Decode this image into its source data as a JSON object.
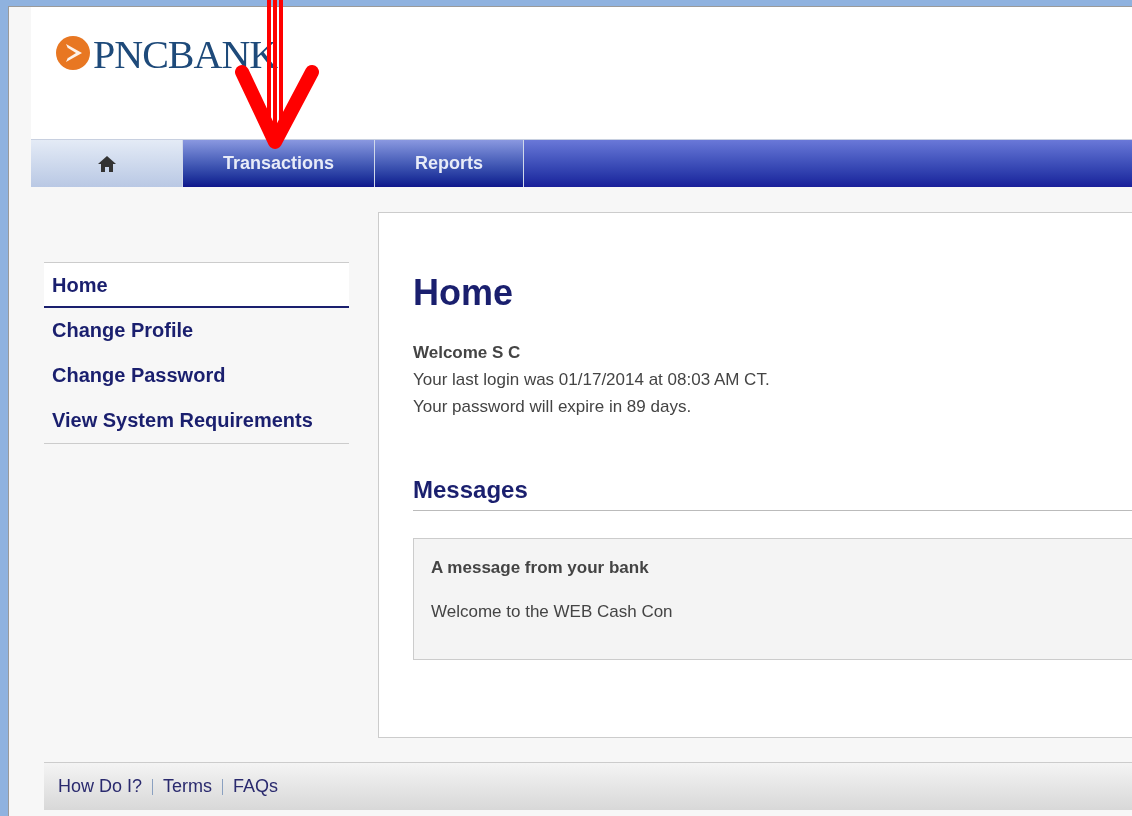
{
  "logo": {
    "text": "PNCBANK"
  },
  "nav_tabs": [
    {
      "kind": "icon",
      "selected": true
    },
    {
      "kind": "text",
      "label": "Transactions",
      "selected": false
    },
    {
      "kind": "text",
      "label": "Reports",
      "selected": false
    }
  ],
  "sidebar": {
    "items": [
      {
        "label": "Home",
        "selected": true
      },
      {
        "label": "Change Profile",
        "selected": false
      },
      {
        "label": "Change Password",
        "selected": false
      },
      {
        "label": "View System Requirements",
        "selected": false
      }
    ]
  },
  "main": {
    "title": "Home",
    "welcome": "Welcome S C",
    "lines": [
      "Your last login was 01/17/2014 at 08:03 AM CT.",
      "Your password will expire in 89 days."
    ],
    "messages_heading": "Messages",
    "message": {
      "title": "A message from your bank",
      "body": "Welcome to the WEB Cash Con"
    }
  },
  "footer_links": [
    "How Do I?",
    "Terms",
    "FAQs"
  ],
  "annotation": {
    "kind": "arrow"
  }
}
